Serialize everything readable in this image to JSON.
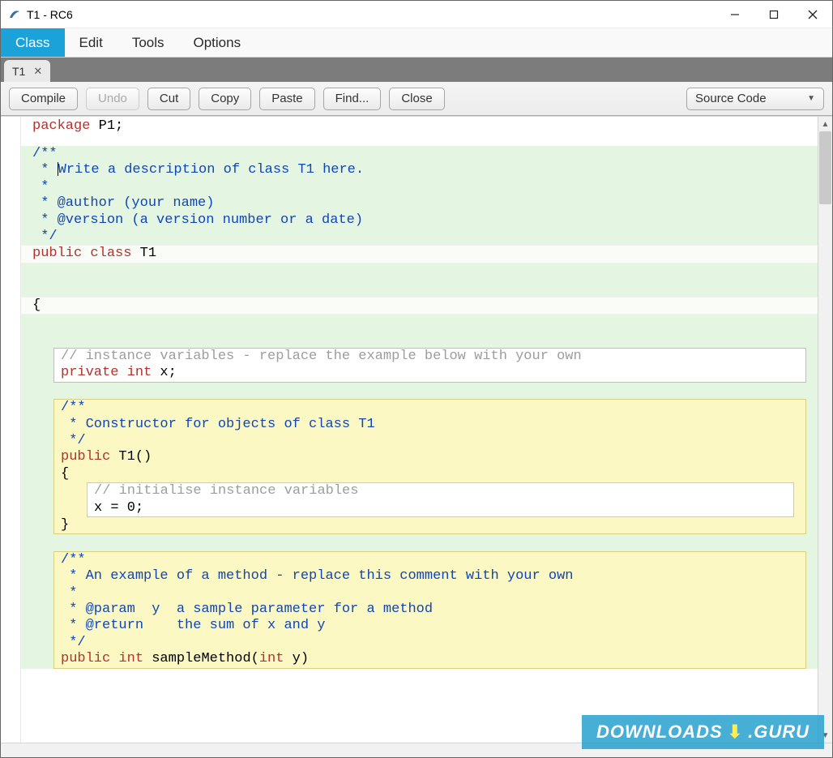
{
  "window": {
    "title": "T1 - RC6"
  },
  "menubar": {
    "items": [
      "Class",
      "Edit",
      "Tools",
      "Options"
    ],
    "active_index": 0
  },
  "tabs": [
    {
      "label": "T1"
    }
  ],
  "toolbar": {
    "compile": "Compile",
    "undo": "Undo",
    "cut": "Cut",
    "copy": "Copy",
    "paste": "Paste",
    "find": "Find...",
    "close": "Close",
    "view_selector": "Source Code"
  },
  "code": {
    "l1_kw": "package",
    "l1_name": " P1;",
    "jd_open": "/**",
    "jd_l1": " * ",
    "jd_l1b": "Write a description of class T1 here.",
    "jd_l2": " *",
    "jd_l3": " * @author (your name)",
    "jd_l4": " * @version (a version number or a date)",
    "jd_close": " */",
    "cl_kw1": "public",
    "cl_kw2": " class",
    "cl_name": " T1",
    "brace_open": "{",
    "inst_cmt": "// instance variables - replace the example below with your own",
    "priv_kw": "private",
    "priv_type": " int",
    "priv_rest": " x;",
    "ctor_jd": [
      "/**",
      " * Constructor for objects of class T1",
      " */"
    ],
    "ctor_kw": "public",
    "ctor_rest": " T1()",
    "ctor_open": "{",
    "ctor_cmt": "// initialise instance variables",
    "ctor_body": "x = 0;",
    "ctor_close": "}",
    "m_jd": [
      "/**",
      " * An example of a method - replace this comment with your own",
      " *",
      " * @param  y  a sample parameter for a method",
      " * @return    the sum of x and y",
      " */"
    ],
    "m_kw1": "public",
    "m_kw2": " int",
    "m_name": " sampleMethod(",
    "m_kw3": "int",
    "m_rest": " y)"
  },
  "watermark": {
    "left": "DOWNLOADS",
    "dot": "✿",
    "right": ".GURU"
  }
}
